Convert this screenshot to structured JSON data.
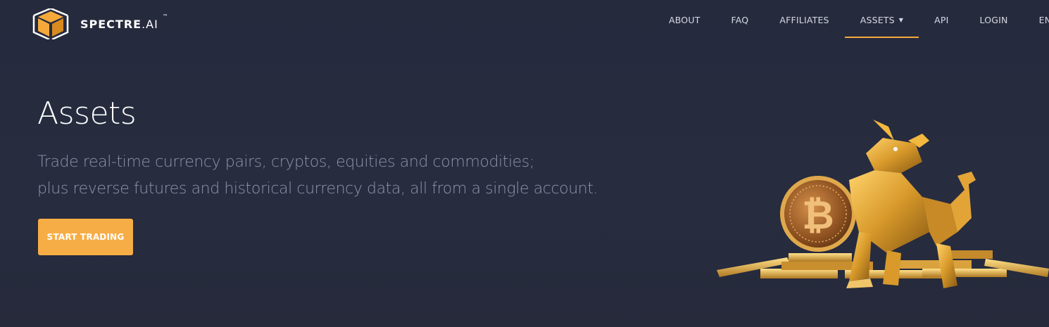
{
  "header": {
    "brand": "SPECTRE",
    "brand_suffix": ".AI",
    "trademark": "™",
    "nav": [
      {
        "label": "ABOUT"
      },
      {
        "label": "FAQ"
      },
      {
        "label": "AFFILIATES"
      },
      {
        "label": "ASSETS",
        "active": true,
        "dropdown": true
      },
      {
        "label": "API"
      },
      {
        "label": "LOGIN"
      },
      {
        "label": "EN"
      }
    ]
  },
  "hero": {
    "title": "Assets",
    "subtitle_line1": "Trade real-time currency pairs, cryptos, equities and commodities;",
    "subtitle_line2": "plus reverse futures and historical currency data, all from a single account.",
    "cta_label": "START TRADING"
  },
  "colors": {
    "background": "#262a3c",
    "accent": "#f6a93b",
    "nav_text": "#d7dae3",
    "subtitle_text": "#8f96a9"
  },
  "icons": [
    "spectre-logo-icon",
    "dropdown-caret-icon",
    "bitcoin-bull-illustration"
  ]
}
